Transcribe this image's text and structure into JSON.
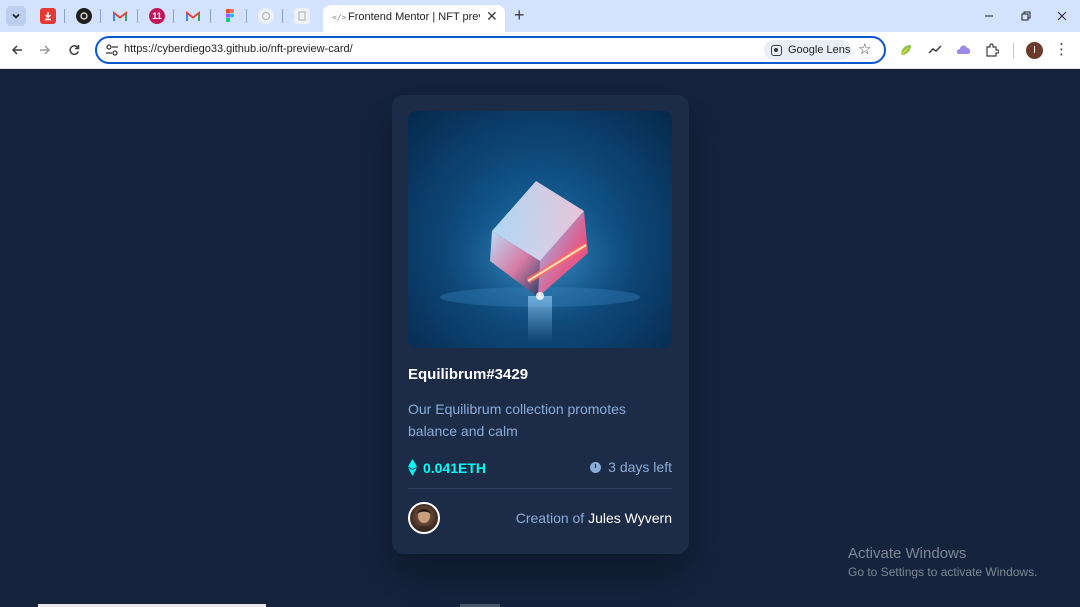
{
  "browser": {
    "active_tab_title": "Frontend Mentor | NFT preview card component",
    "new_tab_icon": "plus-icon",
    "url": "https://cyberdiego33.github.io/nft-preview-card/",
    "lens_label": "Google Lens",
    "profile_initial": "I",
    "pinned_tabs": [
      {
        "name": "download-icon",
        "color": "#e53935"
      },
      {
        "name": "threads-icon",
        "color": "#1f1f1f"
      },
      {
        "name": "gmail-icon",
        "color": "#ea4335"
      },
      {
        "name": "app-icon",
        "color": "#c2185b"
      },
      {
        "name": "gmail-icon",
        "color": "#ea4335"
      },
      {
        "name": "figma-icon",
        "color": "#f24e1e"
      },
      {
        "name": "chatgpt-icon",
        "color": "#d0d0d0"
      },
      {
        "name": "doc-icon",
        "color": "#e0e0e0"
      }
    ]
  },
  "card": {
    "title": "Equilibrum#3429",
    "description": "Our Equilibrum collection promotes balance and calm",
    "price": "0.041ETH",
    "days_left": "3 days left",
    "creation_prefix": "Creation of",
    "creator": "Jules Wyvern",
    "colors": {
      "accent": "#00fff8",
      "text_muted": "#8bacd9",
      "card_bg": "#1c2b46",
      "page_bg": "#15233d"
    }
  },
  "watermark": {
    "title": "Activate Windows",
    "subtitle": "Go to Settings to activate Windows."
  }
}
